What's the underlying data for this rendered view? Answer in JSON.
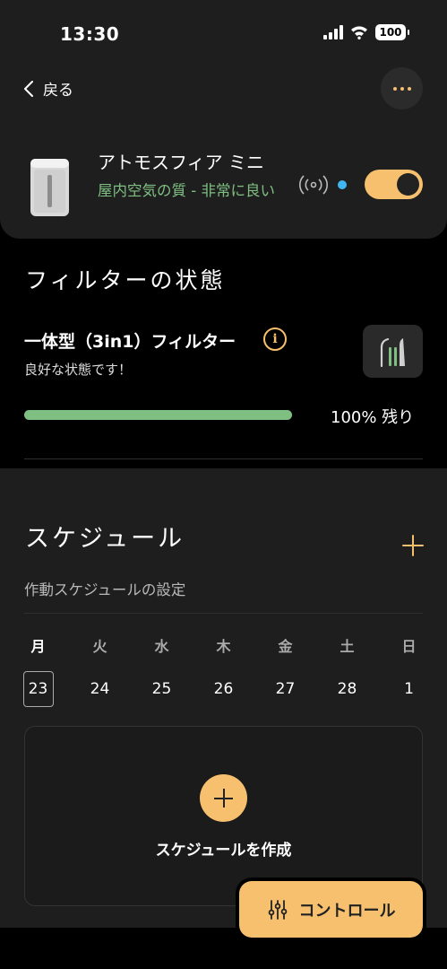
{
  "status_bar": {
    "time": "13:30",
    "battery": "100"
  },
  "header": {
    "back_label": "戻る"
  },
  "device": {
    "name": "アトモスフィア ミニ",
    "air_quality": "屋内空気の質 - 非常に良い",
    "power_on": true
  },
  "filter": {
    "section_title": "フィルターの状態",
    "name": "一体型（3in1）フィルター",
    "info_icon": "i",
    "status": "良好な状態です！",
    "remaining_percent": 100,
    "remaining_label": "100% 残り"
  },
  "schedule": {
    "section_title": "スケジュール",
    "subtitle": "作動スケジュールの設定",
    "weekdays": [
      "月",
      "火",
      "水",
      "木",
      "金",
      "土",
      "日"
    ],
    "dates": [
      "23",
      "24",
      "25",
      "26",
      "27",
      "28",
      "1"
    ],
    "selected_index": 0,
    "create_label": "スケジュールを作成"
  },
  "control_button": {
    "label": "コントロール"
  },
  "colors": {
    "accent": "#f6c06e",
    "good": "#7fbf82",
    "connected": "#3fb6f2",
    "surface": "#1e1e1e"
  }
}
